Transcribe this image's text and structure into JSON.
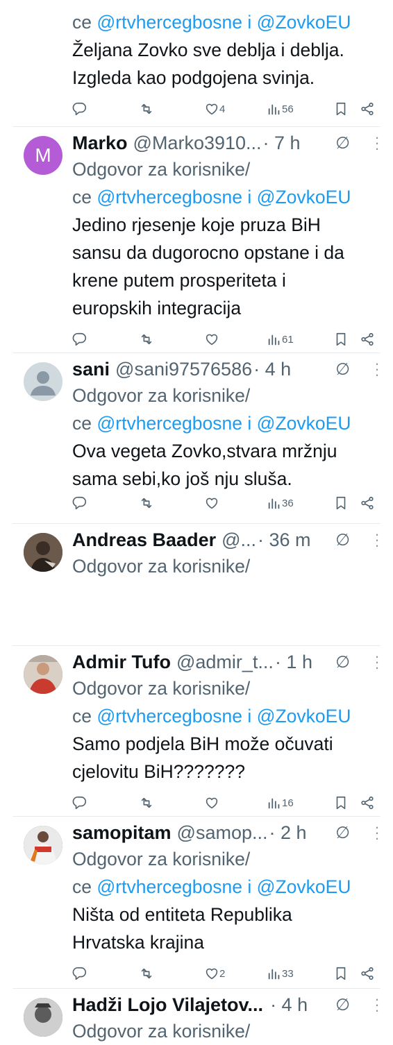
{
  "first": {
    "mention_prefix": "ce",
    "mention_1": "@rtvhercegbosne",
    "mention_joiner": "i",
    "mention_2": "@ZovkoEU",
    "text_1": "Željana Zovko sve deblja i deblja.",
    "text_2": "Izgleda kao podgojena svinja.",
    "likes": "4",
    "views": "56"
  },
  "tweets": [
    {
      "avatar_letter": "M",
      "name": "Marko",
      "handle": "@Marko3910...",
      "time": "· 7 h",
      "reply_to": "Odgovor za korisnike/",
      "mention_prefix": "ce",
      "mention_1": "@rtvhercegbosne",
      "mention_joiner": "i",
      "mention_2": "@ZovkoEU",
      "text": [
        "Jedino rjesenje koje pruza BiH",
        "sansu da dugorocno opstane i da",
        "krene putem prosperiteta i",
        "europskih integracija"
      ],
      "likes": "",
      "views": "61"
    },
    {
      "name": "sani",
      "handle": "@sani97576586",
      "time": "· 4 h",
      "reply_to": "Odgovor za korisnike/",
      "mention_prefix": "ce",
      "mention_1": "@rtvhercegbosne",
      "mention_joiner": "i",
      "mention_2": "@ZovkoEU",
      "text": [
        "Ova vegeta Zovko,stvara mržnju",
        "sama sebi,ko još nju sluša."
      ],
      "likes": "",
      "views": "36"
    },
    {
      "name": "Andreas Baader",
      "handle": "@...",
      "time": "· 36 m",
      "reply_to": "Odgovor za korisnike/"
    },
    {
      "name": "Admir Tufo",
      "handle": "@admir_t...",
      "time": "· 1 h",
      "reply_to": "Odgovor za korisnike/",
      "mention_prefix": "ce",
      "mention_1": "@rtvhercegbosne",
      "mention_joiner": "i",
      "mention_2": "@ZovkoEU",
      "text": [
        "Samo podjela BiH može očuvati",
        "cjelovitu BiH???????"
      ],
      "likes": "",
      "views": "16"
    },
    {
      "name": "samopitam",
      "handle": "@samop...",
      "time": "· 2 h",
      "reply_to": "Odgovor za korisnike/",
      "mention_prefix": "ce",
      "mention_1": "@rtvhercegbosne",
      "mention_joiner": "i",
      "mention_2": "@ZovkoEU",
      "text": [
        "Ništa od entiteta Republika",
        "Hrvatska krajina"
      ],
      "likes": "2",
      "views": "33"
    },
    {
      "name": "Hadži Lojo Vilajetov...",
      "time": "· 4 h",
      "reply_to": "Odgovor za korisnike/"
    }
  ],
  "icons": {
    "reply": "reply-icon",
    "retweet": "retweet-icon",
    "like": "heart-icon",
    "views": "views-icon",
    "bookmark": "bookmark-icon",
    "share": "share-icon",
    "grok": "grok-icon",
    "more": "more-icon"
  },
  "colors": {
    "link": "#1d9bf0",
    "secondary": "#536471",
    "divider": "#e7ebee",
    "avatar_letter_bg": "#b45bd6"
  }
}
